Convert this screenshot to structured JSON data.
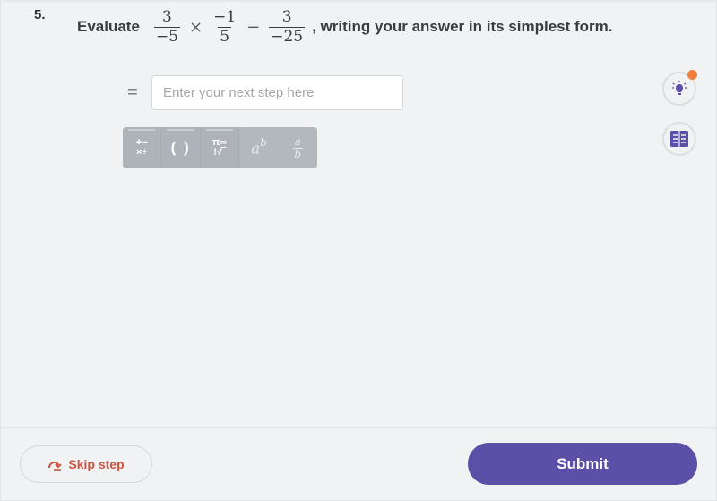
{
  "question": {
    "number": "5.",
    "prefix": "Evaluate",
    "fractions": [
      {
        "numerator": "3",
        "denominator": "−5"
      },
      {
        "numerator": "−1",
        "denominator": "5"
      },
      {
        "numerator": "3",
        "denominator": "−25"
      }
    ],
    "operators": [
      "×",
      "−"
    ],
    "suffix": ", writing your answer in its simplest form."
  },
  "answer": {
    "equals": "=",
    "placeholder": "Enter your next step here",
    "value": ""
  },
  "keypad": {
    "keys": [
      {
        "name": "operations",
        "label": "+−\n×÷",
        "icon": "operations-icon"
      },
      {
        "name": "brackets",
        "label": "( )",
        "icon": "brackets-icon"
      },
      {
        "name": "symbols",
        "label": "π∞\n!√‾",
        "icon": "symbols-icon"
      },
      {
        "name": "power",
        "base": "a",
        "exponent": "b",
        "icon": "power-icon"
      },
      {
        "name": "fraction",
        "numerator": "a",
        "denominator": "b",
        "icon": "fraction-icon"
      }
    ]
  },
  "side": {
    "hint_icon": "lightbulb-icon",
    "hint_notification": true,
    "book_icon": "book-icon"
  },
  "footer": {
    "skip_label": "Skip step",
    "submit_label": "Submit"
  },
  "colors": {
    "accent": "#5c4fa8",
    "skip": "#cf5440",
    "notification": "#f0803c",
    "background": "#f1f2f4"
  }
}
